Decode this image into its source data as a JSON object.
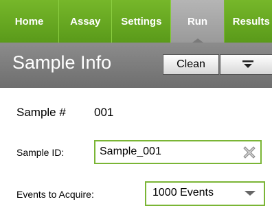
{
  "nav": {
    "tabs": [
      {
        "label": "Home"
      },
      {
        "label": "Assay"
      },
      {
        "label": "Settings"
      },
      {
        "label": "Run"
      },
      {
        "label": "Results"
      }
    ]
  },
  "header": {
    "title": "Sample Info",
    "clean_label": "Clean",
    "filter_icon": "filter-menu-icon"
  },
  "form": {
    "sample_number_label": "Sample #",
    "sample_number_value": "001",
    "sample_id_label": "Sample ID:",
    "sample_id_value": "Sample_001",
    "events_label": "Events to Acquire:",
    "events_value": "1000 Events"
  },
  "colors": {
    "nav_green": "#6aaa22",
    "active_tab_gray": "#a8a8a8",
    "header_gray": "#7d7d7d",
    "field_border_green": "#7ab535"
  }
}
